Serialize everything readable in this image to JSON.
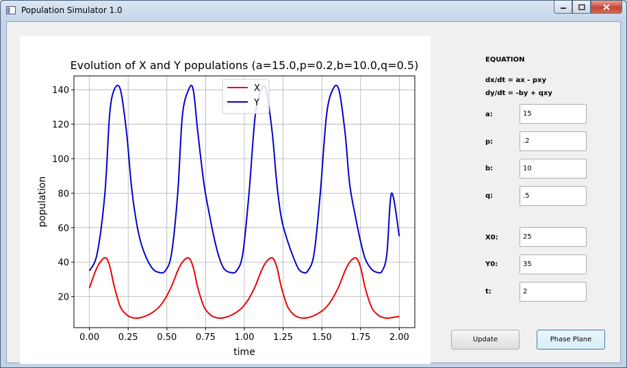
{
  "window": {
    "title": "Population Simulator 1.0"
  },
  "panel": {
    "equation_heading": "EQUATION",
    "eq1": "dx/dt = ax - pxy",
    "eq2": "dy/dt = -by + qxy",
    "fields": {
      "a": {
        "label": "a:",
        "value": "15"
      },
      "p": {
        "label": "p:",
        "value": ".2"
      },
      "b": {
        "label": "b:",
        "value": "10"
      },
      "q": {
        "label": "q:",
        "value": ".5"
      },
      "x0": {
        "label": "X0:",
        "value": "25"
      },
      "y0": {
        "label": "Y0:",
        "value": "35"
      },
      "t": {
        "label": "t:",
        "value": "2"
      }
    },
    "update_label": "Update",
    "phase_plane_label": "Phase Plane"
  },
  "chart_data": {
    "type": "line",
    "title": "Evolution of X and Y populations (a=15.0,p=0.2,b=10.0,q=0.5)",
    "xlabel": "time",
    "ylabel": "population",
    "xlim": [
      -0.1,
      2.1
    ],
    "ylim": [
      2,
      148
    ],
    "x_ticks": [
      "0.00",
      "0.25",
      "0.50",
      "0.75",
      "1.00",
      "1.25",
      "1.50",
      "1.75",
      "2.00"
    ],
    "y_ticks": [
      "20",
      "40",
      "60",
      "80",
      "100",
      "120",
      "140"
    ],
    "grid": true,
    "legend_position": "top-center",
    "x": [
      0.0,
      0.05,
      0.1,
      0.13,
      0.16,
      0.2,
      0.24,
      0.27,
      0.3,
      0.33,
      0.37,
      0.41,
      0.45,
      0.49,
      0.53,
      0.57,
      0.6,
      0.64,
      0.67,
      0.7,
      0.74,
      0.78,
      0.81,
      0.84,
      0.87,
      0.91,
      0.95,
      0.99,
      1.03,
      1.07,
      1.11,
      1.14,
      1.18,
      1.21,
      1.24,
      1.28,
      1.32,
      1.35,
      1.38,
      1.41,
      1.45,
      1.49,
      1.53,
      1.57,
      1.61,
      1.65,
      1.68,
      1.72,
      1.75,
      1.78,
      1.82,
      1.86,
      1.89,
      1.92,
      1.95,
      2.0
    ],
    "series": [
      {
        "name": "X",
        "color": "#ee0000",
        "values": [
          25,
          37,
          42.5,
          38,
          26,
          14,
          9.5,
          8,
          7.5,
          7.8,
          9,
          11,
          14,
          19,
          26,
          35,
          40,
          42.5,
          37,
          25,
          14,
          9.5,
          8,
          7.5,
          7.8,
          9,
          11,
          14,
          19,
          26,
          35,
          40,
          42.5,
          37,
          25,
          14,
          9.5,
          8,
          7.5,
          7.8,
          9,
          11,
          14,
          19,
          26,
          35,
          40,
          42.5,
          37,
          25,
          14,
          9.5,
          8,
          7.5,
          7.8,
          8.5
        ]
      },
      {
        "name": "Y",
        "color": "#0000cc",
        "values": [
          35,
          45,
          80,
          125,
          140,
          140,
          115,
          85,
          65,
          52,
          42,
          36,
          34,
          35,
          45,
          80,
          125,
          140,
          140,
          115,
          85,
          65,
          52,
          42,
          36,
          34,
          35,
          45,
          80,
          125,
          140,
          140,
          115,
          85,
          65,
          52,
          42,
          36,
          34,
          35,
          45,
          80,
          125,
          140,
          140,
          115,
          85,
          65,
          52,
          42,
          36,
          34,
          35,
          45,
          80,
          55
        ]
      }
    ]
  }
}
